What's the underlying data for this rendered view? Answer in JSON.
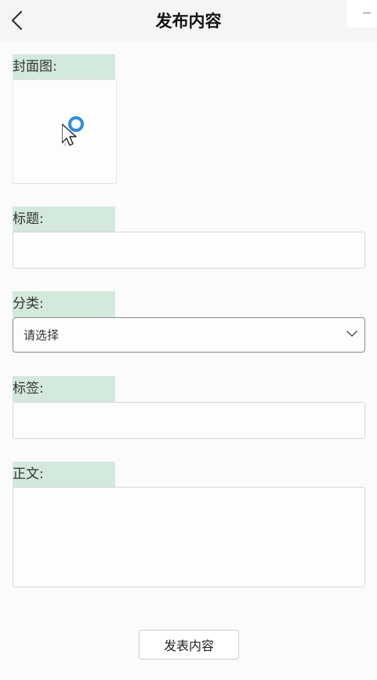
{
  "header": {
    "title": "发布内容",
    "back_icon": "chevron-left-icon",
    "window_control_icon": "minimize-icon"
  },
  "form": {
    "cover": {
      "label": "封面图:",
      "upload_icon": "cursor-loading-icon"
    },
    "title": {
      "label": "标题:",
      "value": ""
    },
    "category": {
      "label": "分类:",
      "selected": "请选择",
      "dropdown_icon": "chevron-down-icon"
    },
    "tags": {
      "label": "标签:",
      "value": ""
    },
    "body": {
      "label": "正文:",
      "value": ""
    },
    "submit_label": "发表内容"
  },
  "colors": {
    "label_highlight": "#d3e9dc",
    "loading_ring": "#2b8fe8",
    "page_background": "#fbfbfb"
  }
}
